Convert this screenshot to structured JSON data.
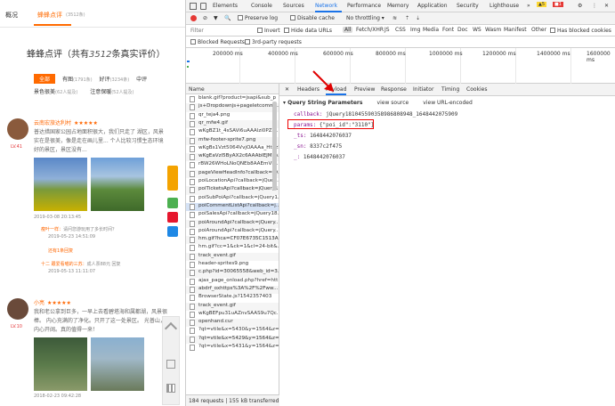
{
  "left": {
    "tabs": [
      "概况",
      "蜂蜂点评",
      "(3512条)"
    ],
    "title_prefix": "蜂蜂点评（共有",
    "title_num": "3512",
    "title_suffix": "条真实评价）",
    "filters": {
      "row1": [
        {
          "label": "全部",
          "count": ""
        },
        {
          "label": "有图",
          "count": "(1791条)"
        },
        {
          "label": "好评",
          "count": "(3234条)"
        },
        {
          "label": "中评",
          "count": ""
        }
      ],
      "row2": [
        {
          "label": "景色很美",
          "count": "(62人提及)"
        },
        {
          "label": "注意保暖",
          "count": "(52人提及)"
        }
      ]
    },
    "reviews": [
      {
        "user": "云南宏旅达利村",
        "stars": "★★★★★",
        "level": "LV.41",
        "text": "普达措国家公园占地面积很大，我们只走了 湖区，风景实在是很美，像是走在画儿里... 个人比较习惯生态环境好的景区，景区没有...",
        "date": "2019-03-08 20:13:45",
        "reply_user": "瘦叶一样：",
        "reply_text": "请问您游玩用了多长时间？",
        "reply_date": "2019-05-23 14:51:09",
        "reply_link": "还有1条回复",
        "reply2_user": "十二 跟爱看喵的三苏：",
        "reply2_text": "成人票88元 回复",
        "reply2_date": "2019-05-13 11:11:07"
      },
      {
        "user": "小亮",
        "stars": "★★★★★",
        "level": "LV.10",
        "text": "我和老公拿到巨多，一早上去看碧塔海和属都湖，风景很棒。 内心充满的了净化。只开了这一处景区。 光普山，内心开阔。真的值得一来！",
        "date": "2018-02-23 09:42:28"
      }
    ]
  },
  "devtools": {
    "top_tabs": [
      "Elements",
      "Console",
      "Sources",
      "Network",
      "Performance",
      "Memory",
      "Application",
      "Security",
      "Lighthouse"
    ],
    "active_tab": "Network",
    "warn_count": "5",
    "err_count": "1",
    "more": "»",
    "toolbar": {
      "preserve_log": "Preserve log",
      "disable_cache": "Disable cache",
      "throttling": "No throttling"
    },
    "filter": {
      "placeholder": "Filter",
      "invert": "Invert",
      "hide_data_urls": "Hide data URLs",
      "types": [
        "All",
        "Fetch/XHR",
        "JS",
        "CSS",
        "Img",
        "Media",
        "Font",
        "Doc",
        "WS",
        "Wasm",
        "Manifest",
        "Other"
      ],
      "has_blocked": "Has blocked cookies",
      "blocked_requests": "Blocked Requests",
      "third_party": "3rd-party requests"
    },
    "timeline_ticks": [
      "200000 ms",
      "400000 ms",
      "600000 ms",
      "800000 ms",
      "1000000 ms",
      "1200000 ms",
      "1400000 ms",
      "1600000 ms"
    ],
    "list_header": "Name",
    "requests": [
      "blank.gif?product=jsapi&sub_p",
      "js+Dropdownjs+pageletcomm...",
      "qr_teja4.png",
      "qr_mfw4.gif",
      "wKgBZ1t_4sSAVi6uAAAlzi0PZg...",
      "mfw-footer-sprite7.png",
      "wKgBs1Vzt5064VvjOAAAa_Htuz5...",
      "wKgEaVzl5ByAX2c6AAAbIEJMLo...",
      "rBW26WHoLNoQNEb8AAEmVh...",
      "pageViewHeadInfo?callback=jQ...",
      "poiLocationApi?callback=jQuer...",
      "poiTicketsApi?callback=jQuery1...",
      "poiSubPoiApi?callback=jQuery1...",
      "poiCommentListApi?callback=j...",
      "poiSalesApi?callback=jQuery18...",
      "poiAroundApi?callback=jQuery...",
      "poiAroundApi?callback=jQuery...",
      "hm.gif?hca=CF07E6735C1513A...",
      "hm.gif?cc=1&ck=1&cl=24-bit&...",
      "track_event.gif",
      "header-sprites9.png",
      "c.php?id=30065558&web_id=3...",
      "ajax_page_onload.php?href=htt...",
      "abdrf_oxhttps%3A%2F%2Fww...",
      "BrowserState.js?1542357403",
      "track_event.gif",
      "wKgBEFpu31uAZnvSAAS9u7Qc...",
      "openhand.cur",
      "?qt=vtile&x=5430&y=1564&z=...",
      "?qt=vtile&x=5429&y=1564&z=...",
      "?qt=vtile&x=5431&y=1564&z=..."
    ],
    "status": "184 requests  |  155 kB transferred",
    "detail_tabs": [
      "Headers",
      "Payload",
      "Preview",
      "Response",
      "Initiator",
      "Timing",
      "Cookies"
    ],
    "active_detail_tab": "Payload",
    "qsp_title": "Query String Parameters",
    "view_source": "view source",
    "view_url_encoded": "view URL-encoded",
    "params": [
      {
        "key": "callback:",
        "value": "jQuery181045590358986808948_1648442075909"
      },
      {
        "key": "params:",
        "value": "{\"poi_id\":\"3110\"}"
      },
      {
        "key": "_ts:",
        "value": "1648442076037"
      },
      {
        "key": "_sn:",
        "value": "8337c2f475"
      },
      {
        "key": "_:",
        "value": "1648442076037"
      }
    ],
    "colors": {
      "accent": "#1a73e8",
      "highlight": "#e00000",
      "selected_row": "#d5e2f5"
    }
  }
}
